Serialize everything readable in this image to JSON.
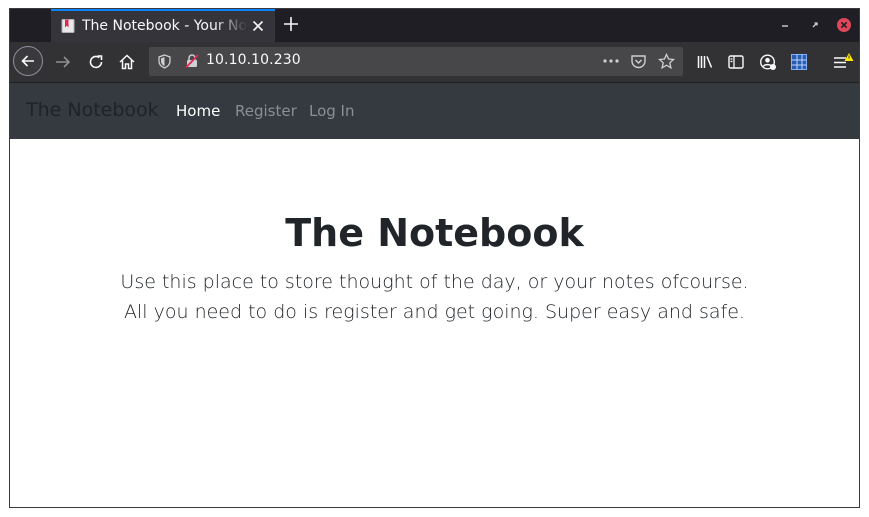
{
  "browser": {
    "tab_title": "The Notebook - Your Notes",
    "url": "10.10.10.230",
    "accent_color": "#0a84ff"
  },
  "navbar": {
    "brand": "The Notebook",
    "links": [
      {
        "label": "Home",
        "active": true
      },
      {
        "label": "Register",
        "active": false
      },
      {
        "label": "Log In",
        "active": false
      }
    ]
  },
  "main": {
    "heading": "The Notebook",
    "lines": [
      "Use this place to store thought of the day, or your notes ofcourse.",
      "All you need to do is register and get going. Super easy and safe."
    ]
  }
}
